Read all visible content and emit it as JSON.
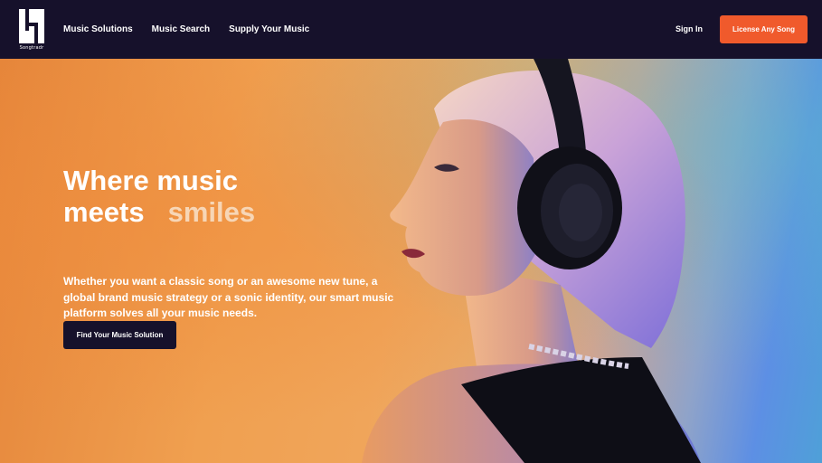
{
  "brand": {
    "logo_text": "Songtradr"
  },
  "nav": {
    "links": [
      {
        "label": "Music Solutions"
      },
      {
        "label": "Music Search"
      },
      {
        "label": "Supply Your Music"
      }
    ],
    "sign_in": "Sign In",
    "cta": "License Any Song"
  },
  "hero": {
    "headline_line1": "Where music",
    "headline_line2_a": "meets",
    "headline_line2_b": "smiles",
    "description": "Whether you want a classic song or an awesome new tune, a global brand music strategy or a sonic identity, our smart music platform solves all your music needs.",
    "button": "Find Your Music Solution"
  },
  "colors": {
    "nav_bg": "#16112b",
    "accent_orange": "#f05a2c",
    "hero_orange": "#f0a050",
    "hero_blue": "#5d8fe4",
    "headline_accent": "#f7d6b6"
  },
  "images": {
    "hero_photo": "woman-with-headphones-photo"
  }
}
